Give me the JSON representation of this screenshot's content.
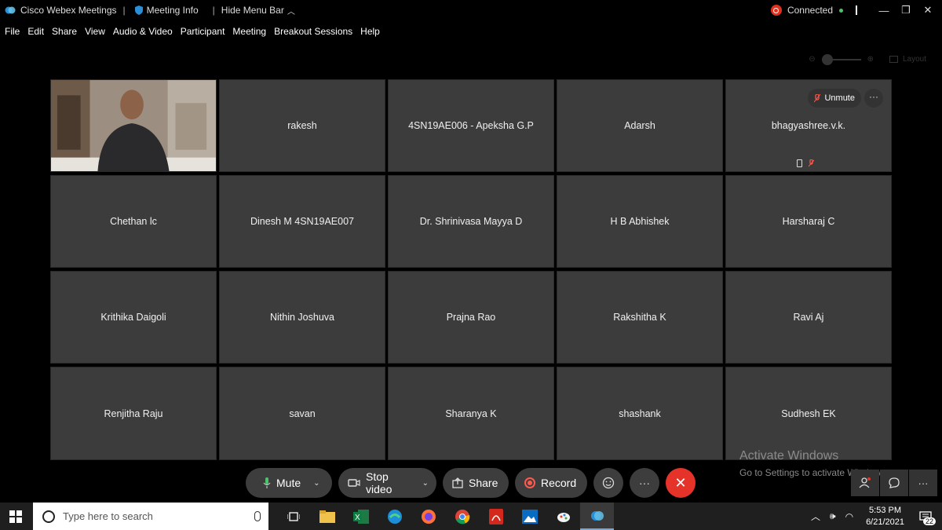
{
  "titlebar": {
    "app_title": "Cisco Webex Meetings",
    "meeting_info": "Meeting Info",
    "hide_menu": "Hide Menu Bar",
    "status": "Connected"
  },
  "menu": [
    "File",
    "Edit",
    "Share",
    "View",
    "Audio & Video",
    "Participant",
    "Meeting",
    "Breakout Sessions",
    "Help"
  ],
  "layout_label": "Layout",
  "participants": [
    {
      "name": ""
    },
    {
      "name": "rakesh"
    },
    {
      "name": "4SN19AE006 - Apeksha G.P"
    },
    {
      "name": "Adarsh"
    },
    {
      "name": "bhagyashree.v.k."
    },
    {
      "name": "Chethan lc"
    },
    {
      "name": "Dinesh M 4SN19AE007"
    },
    {
      "name": "Dr. Shrinivasa Mayya D"
    },
    {
      "name": "H B Abhishek"
    },
    {
      "name": "Harsharaj C"
    },
    {
      "name": "Krithika Daigoli"
    },
    {
      "name": "Nithin Joshuva"
    },
    {
      "name": "Prajna Rao"
    },
    {
      "name": "Rakshitha K"
    },
    {
      "name": "Ravi Aj"
    },
    {
      "name": "Renjitha Raju"
    },
    {
      "name": "savan"
    },
    {
      "name": "Sharanya K"
    },
    {
      "name": "shashank"
    },
    {
      "name": "Sudhesh EK"
    }
  ],
  "tile_actions": {
    "unmute": "Unmute",
    "more": "···"
  },
  "watermark": {
    "line1": "Activate Windows",
    "line2": "Go to Settings to activate Windows."
  },
  "controls": {
    "mute": "Mute",
    "stop_video": "Stop video",
    "share": "Share",
    "record": "Record",
    "more": "···",
    "end": "✕"
  },
  "taskbar": {
    "search_placeholder": "Type here to search",
    "time": "5:53 PM",
    "date": "6/21/2021",
    "notifications": "22"
  },
  "colors": {
    "tile_bg": "#3c3c3c",
    "end_red": "#e6332a",
    "accent_green": "#4cc36b"
  }
}
